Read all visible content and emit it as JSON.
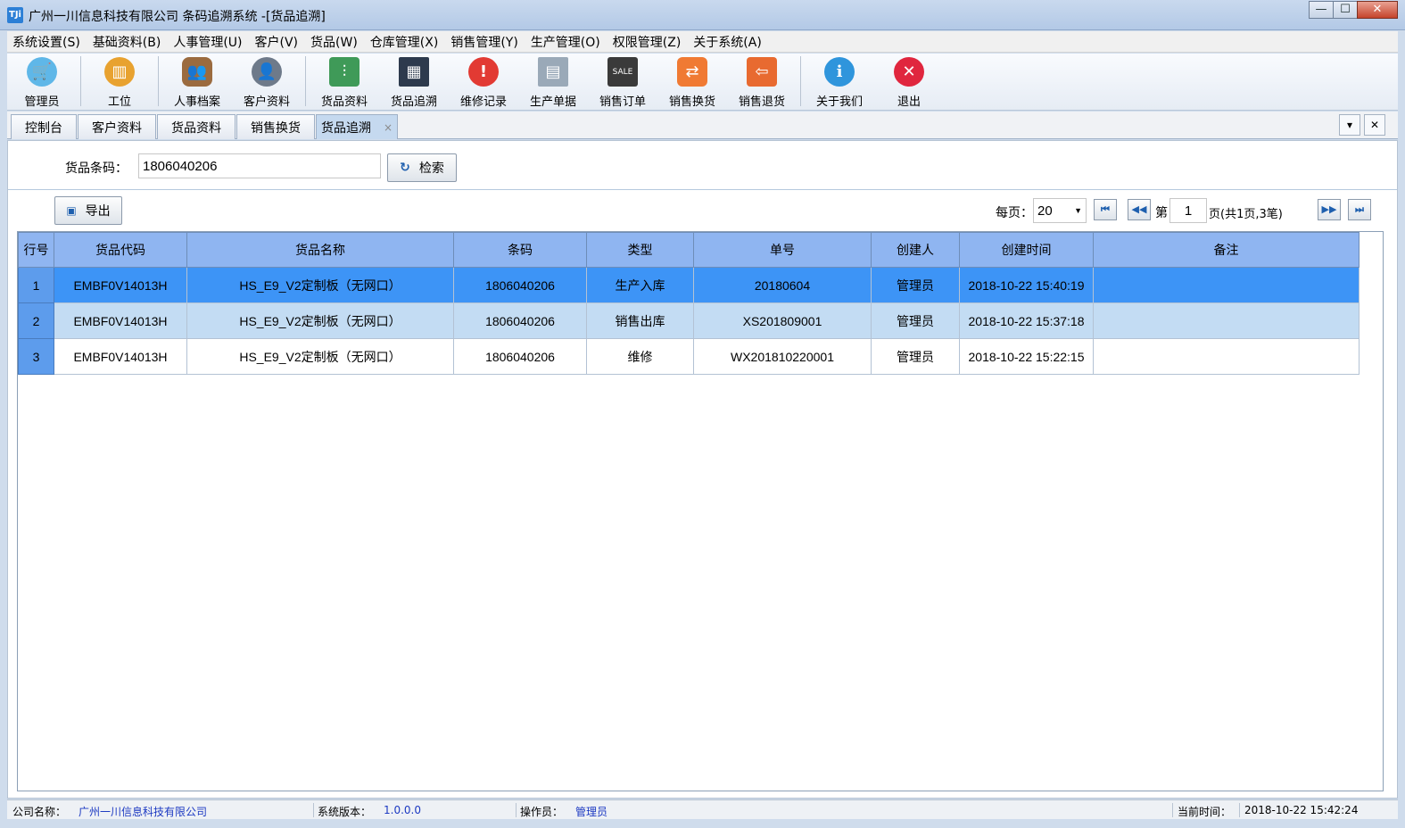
{
  "window": {
    "title": "广州一川信息科技有限公司 条码追溯系统 -[货品追溯]",
    "icon_text": "TJi",
    "minimize": "—",
    "maximize": "☐",
    "close": "✕"
  },
  "menu": [
    {
      "label": "系统设置(S)"
    },
    {
      "label": "基础资料(B)"
    },
    {
      "label": "人事管理(U)"
    },
    {
      "label": "客户(V)"
    },
    {
      "label": "货品(W)"
    },
    {
      "label": "仓库管理(X)"
    },
    {
      "label": "销售管理(Y)"
    },
    {
      "label": "生产管理(O)"
    },
    {
      "label": "权限管理(Z)"
    },
    {
      "label": "关于系统(A)"
    }
  ],
  "toolbar": [
    {
      "label": "管理员",
      "icon": "admin-basket-icon",
      "color": "#5fb7e8"
    },
    {
      "label": "工位",
      "icon": "barcode-station-icon",
      "color": "#e8a230"
    },
    {
      "label": "人事档案",
      "icon": "people-icon",
      "color": "#9b6b3f"
    },
    {
      "label": "客户资料",
      "icon": "customer-icon",
      "color": "#6e7a8a"
    },
    {
      "label": "货品资料",
      "icon": "components-icon",
      "color": "#3f9a58"
    },
    {
      "label": "货品追溯",
      "icon": "qrcode-icon",
      "color": "#2d3a4d"
    },
    {
      "label": "维修记录",
      "icon": "alert-icon",
      "color": "#e23a33"
    },
    {
      "label": "生产单据",
      "icon": "document-icon",
      "color": "#9aa9b8"
    },
    {
      "label": "销售订单",
      "icon": "sale-sign-icon",
      "color": "#3a3a3a"
    },
    {
      "label": "销售换货",
      "icon": "exchange-icon",
      "color": "#f07a33"
    },
    {
      "label": "销售退货",
      "icon": "return-icon",
      "color": "#e86a30"
    },
    {
      "label": "关于我们",
      "icon": "info-icon",
      "color": "#2f95dc"
    },
    {
      "label": "退出",
      "icon": "exit-icon",
      "color": "#e0263e"
    }
  ],
  "tabs": [
    {
      "label": "控制台"
    },
    {
      "label": "客户资料"
    },
    {
      "label": "货品资料"
    },
    {
      "label": "销售换货"
    },
    {
      "label": "货品追溯",
      "active": true
    }
  ],
  "tab_close": "×",
  "tab_controls": {
    "dropdown": "▾",
    "close": "✕"
  },
  "search": {
    "label": "货品条码：",
    "value": "1806040206",
    "button": "检索",
    "button_icon": "↻"
  },
  "export_button": {
    "label": "导出",
    "icon": "💾"
  },
  "pager": {
    "per_page_label": "每页：",
    "per_page_value": "20",
    "page_prefix": "第",
    "page_value": "1",
    "page_suffix": "页(共1页,3笔)",
    "first": "⏮",
    "prev": "◀◀",
    "next": "▶▶",
    "last": "⏭"
  },
  "grid": {
    "columns": [
      "行号",
      "货品代码",
      "货品名称",
      "条码",
      "类型",
      "单号",
      "创建人",
      "创建时间",
      "备注"
    ],
    "rows": [
      [
        "1",
        "EMBF0V14013H",
        "HS_E9_V2定制板（无网口）",
        "1806040206",
        "生产入库",
        "20180604",
        "管理员",
        "2018-10-22 15:40:19",
        ""
      ],
      [
        "2",
        "EMBF0V14013H",
        "HS_E9_V2定制板（无网口）",
        "1806040206",
        "销售出库",
        "XS201809001",
        "管理员",
        "2018-10-22 15:37:18",
        ""
      ],
      [
        "3",
        "EMBF0V14013H",
        "HS_E9_V2定制板（无网口）",
        "1806040206",
        "维修",
        "WX201810220001",
        "管理员",
        "2018-10-22 15:22:15",
        ""
      ]
    ]
  },
  "status": {
    "company_label": "公司名称：",
    "company_value": "广州一川信息科技有限公司",
    "version_label": "系统版本：",
    "version_value": "1.0.0.0",
    "operator_label": "操作员：",
    "operator_value": "管理员",
    "time_label": "当前时间：",
    "time_value": "2018-10-22 15:42:24"
  }
}
